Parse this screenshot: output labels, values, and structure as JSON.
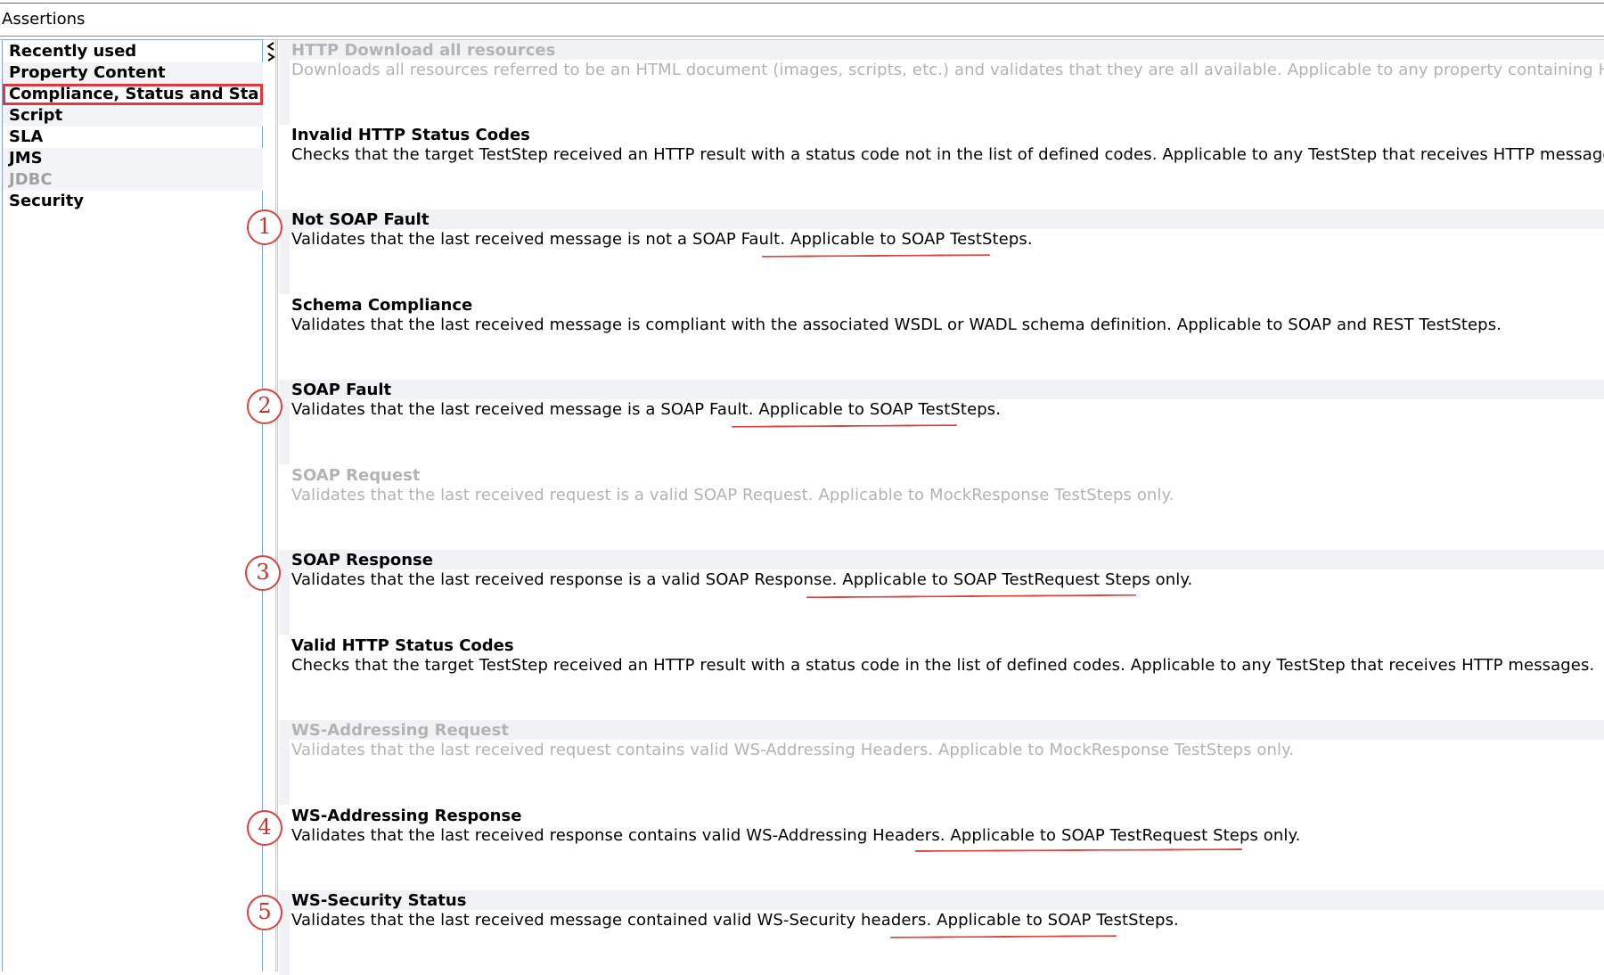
{
  "window": {
    "title": "Assertions"
  },
  "sidebar": {
    "items": [
      {
        "label": "Recently used",
        "state": "normal"
      },
      {
        "label": "Property Content",
        "state": "normal"
      },
      {
        "label": "Compliance, Status and Stand...",
        "state": "selected"
      },
      {
        "label": "Script",
        "state": "normal"
      },
      {
        "label": "SLA",
        "state": "normal"
      },
      {
        "label": "JMS",
        "state": "normal"
      },
      {
        "label": "JDBC",
        "state": "disabled"
      },
      {
        "label": "Security",
        "state": "normal"
      }
    ]
  },
  "assertions": [
    {
      "title": "HTTP Download all resources",
      "description": "Downloads all resources referred to be an HTML document (images, scripts, etc.) and validates that they are all available. Applicable to any property containing HTML.",
      "enabled": false
    },
    {
      "title": "Invalid HTTP Status Codes",
      "description": "Checks that the target TestStep received an HTTP result with a status code not in the list of defined codes. Applicable to any TestStep that receives HTTP messages.",
      "enabled": true
    },
    {
      "title": "Not SOAP Fault",
      "description": "Validates that the last received message is not a SOAP Fault. Applicable to SOAP TestSteps.",
      "enabled": true
    },
    {
      "title": "Schema Compliance",
      "description": "Validates that the last received message is compliant with the associated WSDL or WADL schema definition. Applicable to SOAP and REST TestSteps.",
      "enabled": true
    },
    {
      "title": "SOAP Fault",
      "description": "Validates that the last received message is a SOAP Fault. Applicable to SOAP TestSteps.",
      "enabled": true
    },
    {
      "title": "SOAP Request",
      "description": "Validates that the last received request is a valid SOAP Request. Applicable to MockResponse TestSteps only.",
      "enabled": false
    },
    {
      "title": "SOAP Response",
      "description": "Validates that the last received response is a valid SOAP Response. Applicable to SOAP TestRequest Steps only.",
      "enabled": true
    },
    {
      "title": "Valid HTTP Status Codes",
      "description": "Checks that the target TestStep received an HTTP result with a status code in the list of defined codes. Applicable to any TestStep that receives HTTP messages.",
      "enabled": true
    },
    {
      "title": "WS-Addressing Request",
      "description": "Validates that the last received request contains valid WS-Addressing Headers. Applicable to MockResponse TestSteps only.",
      "enabled": false
    },
    {
      "title": "WS-Addressing Response",
      "description": "Validates that the last received response contains valid WS-Addressing Headers. Applicable to SOAP TestRequest Steps only.",
      "enabled": true
    },
    {
      "title": "WS-Security Status",
      "description": "Validates that the last received message contained valid WS-Security headers. Applicable to SOAP TestSteps.",
      "enabled": true
    }
  ],
  "callouts": [
    "1",
    "2",
    "3",
    "4",
    "5"
  ],
  "colors": {
    "annotation": "#d8453c",
    "selection_border": "#e0393d",
    "disabled_text": "#b3b3b3",
    "row_shade": "#f0f2f5"
  }
}
